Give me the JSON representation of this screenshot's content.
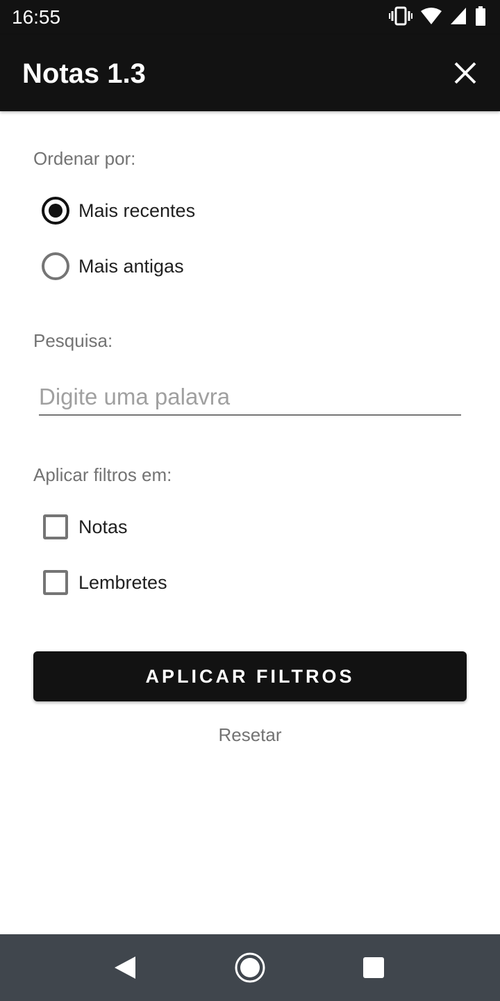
{
  "status_bar": {
    "time": "16:55",
    "icons": [
      "vibrate-icon",
      "wifi-icon",
      "cellular-signal-icon",
      "battery-icon"
    ]
  },
  "app_bar": {
    "title": "Notas 1.3",
    "close_icon": "close-icon"
  },
  "sort": {
    "label": "Ordenar por:",
    "options": [
      {
        "label": "Mais recentes",
        "selected": true
      },
      {
        "label": "Mais antigas",
        "selected": false
      }
    ]
  },
  "search": {
    "label": "Pesquisa:",
    "value": "",
    "placeholder": "Digite uma palavra"
  },
  "filters": {
    "label": "Aplicar filtros em:",
    "options": [
      {
        "label": "Notas",
        "checked": false
      },
      {
        "label": "Lembretes",
        "checked": false
      }
    ]
  },
  "actions": {
    "apply_label": "APLICAR FILTROS",
    "reset_label": "Resetar"
  },
  "nav_bar": {
    "buttons": [
      "back-icon",
      "home-icon",
      "recents-icon"
    ]
  },
  "colors": {
    "primary": "#121212",
    "label_gray": "#737373",
    "nav_bar": "#40464d"
  }
}
